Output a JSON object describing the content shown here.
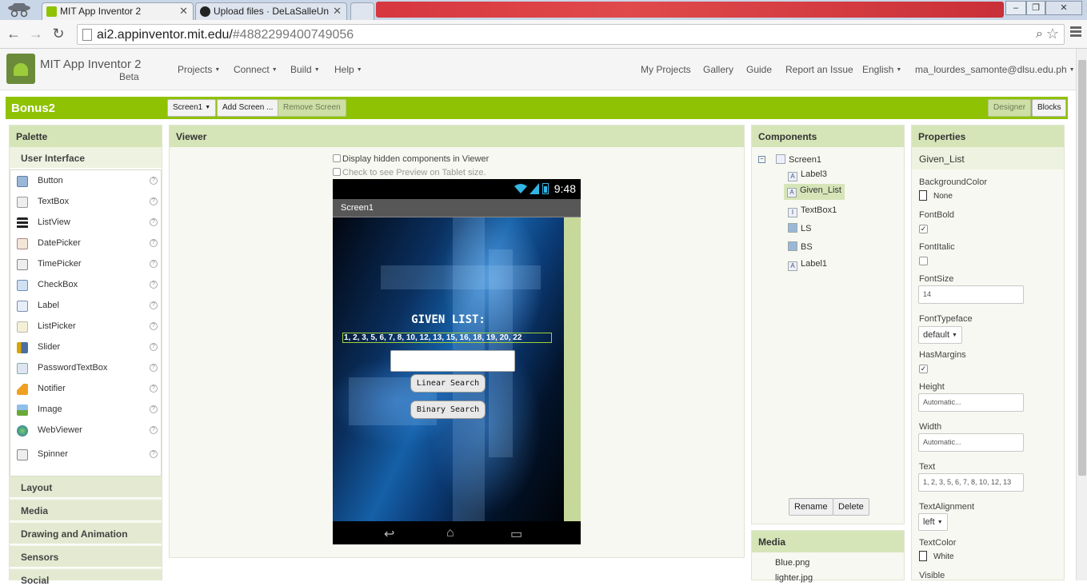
{
  "browser": {
    "tabs": [
      {
        "title": "MIT App Inventor 2"
      },
      {
        "title": "Upload files · DeLaSalleUn"
      }
    ],
    "url_host": "ai2.appinventor.mit.edu/",
    "url_path": "#4882299400749056"
  },
  "header": {
    "brand": "MIT App Inventor 2",
    "beta": "Beta",
    "menus": [
      "Projects",
      "Connect",
      "Build",
      "Help"
    ],
    "right_links": [
      "My Projects",
      "Gallery",
      "Guide",
      "Report an Issue"
    ],
    "language": "English",
    "user": "ma_lourdes_samonte@dlsu.edu.ph"
  },
  "toolbar": {
    "project": "Bonus2",
    "screen_select": "Screen1",
    "add_screen": "Add Screen ...",
    "remove_screen": "Remove Screen",
    "designer": "Designer",
    "blocks": "Blocks",
    "accent": "#8fc202"
  },
  "palette": {
    "title": "Palette",
    "open_category": "User Interface",
    "items": [
      "Button",
      "TextBox",
      "ListView",
      "DatePicker",
      "TimePicker",
      "CheckBox",
      "Label",
      "ListPicker",
      "Slider",
      "PasswordTextBox",
      "Notifier",
      "Image",
      "WebViewer",
      "Spinner"
    ],
    "categories": [
      "Layout",
      "Media",
      "Drawing and Animation",
      "Sensors",
      "Social"
    ]
  },
  "viewer": {
    "title": "Viewer",
    "hidden_check": "Display hidden components in Viewer",
    "tablet_check": "Check to see Preview on Tablet size.",
    "time": "9:48",
    "screen_title": "Screen1",
    "given_title": "GIVEN LIST:",
    "given_list": "1, 2, 3, 5, 6, 7, 8, 10, 12, 13, 15, 16, 18, 19, 20, 22",
    "linear_search": "Linear Search",
    "binary_search": "Binary Search"
  },
  "components": {
    "title": "Components",
    "root": "Screen1",
    "children": [
      "Label3",
      "Given_List",
      "TextBox1",
      "LS",
      "BS",
      "Label1"
    ],
    "selected": "Given_List",
    "rename": "Rename",
    "delete": "Delete"
  },
  "media": {
    "title": "Media",
    "files": [
      "Blue.png",
      "lighter.jpg"
    ]
  },
  "properties": {
    "title": "Properties",
    "component": "Given_List",
    "background_color_label": "BackgroundColor",
    "background_color": "None",
    "font_bold_label": "FontBold",
    "font_italic_label": "FontItalic",
    "font_size_label": "FontSize",
    "font_size": "14",
    "font_typeface_label": "FontTypeface",
    "font_typeface": "default",
    "has_margins_label": "HasMargins",
    "height_label": "Height",
    "height": "Automatic...",
    "width_label": "Width",
    "width": "Automatic...",
    "text_label": "Text",
    "text": "1, 2, 3, 5, 6, 7, 8, 10, 12, 13",
    "text_alignment_label": "TextAlignment",
    "text_alignment": "left",
    "text_color_label": "TextColor",
    "text_color": "White",
    "visible_label": "Visible"
  }
}
